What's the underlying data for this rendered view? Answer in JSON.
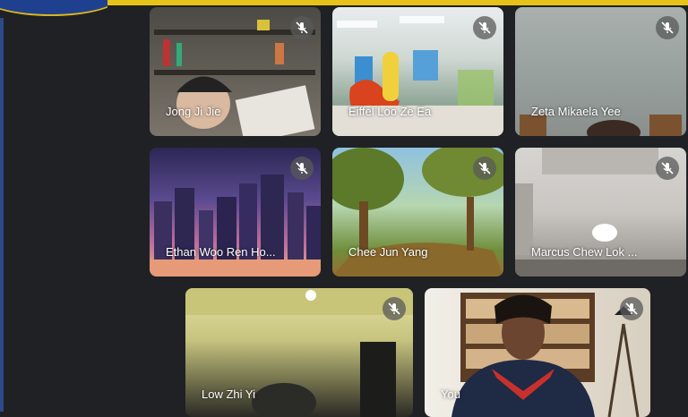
{
  "meeting": {
    "participants": [
      {
        "name": "Jong Ji Jie",
        "muted": true
      },
      {
        "name": "Eiffel Loo Ze Ea",
        "muted": true
      },
      {
        "name": "Zeta Mikaela Yee",
        "muted": true
      },
      {
        "name": "Ethan Woo Ren Ho...",
        "muted": true
      },
      {
        "name": "Chee Jun Yang",
        "muted": true
      },
      {
        "name": "Marcus Chew Lok ...",
        "muted": true
      },
      {
        "name": "Low Zhi Yi",
        "muted": true
      },
      {
        "name": "You",
        "muted": true
      }
    ]
  },
  "icons": {
    "mic": "muted-mic-icon"
  },
  "colors": {
    "background": "#202124",
    "accent_bar": "#e6c21a"
  }
}
